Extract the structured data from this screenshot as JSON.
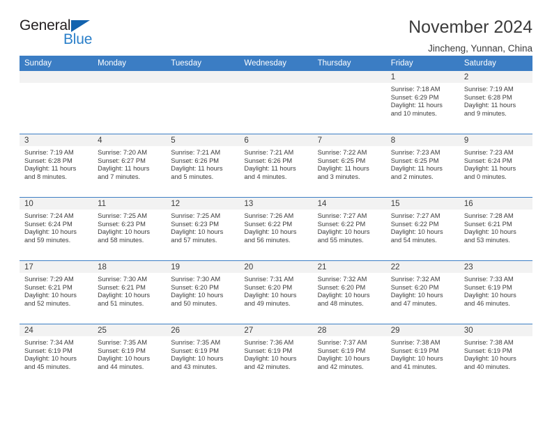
{
  "logo": {
    "word_top": "General",
    "word_bottom": "Blue",
    "triangle_color": "#1363ae",
    "blue_text_color": "#2a7fc9",
    "dark_text_color": "#231f20"
  },
  "header": {
    "title": "November 2024",
    "subtitle": "Jincheng, Yunnan, China"
  },
  "theme": {
    "header_blue": "#3b7dc4",
    "daynum_bg": "#f2f2f2",
    "text": "#3b3b3b"
  },
  "calendar": {
    "weekday_headers": [
      "Sunday",
      "Monday",
      "Tuesday",
      "Wednesday",
      "Thursday",
      "Friday",
      "Saturday"
    ],
    "weeks": [
      [
        {
          "day": "",
          "sunrise": "",
          "sunset": "",
          "daylight_line1": "",
          "daylight_line2": ""
        },
        {
          "day": "",
          "sunrise": "",
          "sunset": "",
          "daylight_line1": "",
          "daylight_line2": ""
        },
        {
          "day": "",
          "sunrise": "",
          "sunset": "",
          "daylight_line1": "",
          "daylight_line2": ""
        },
        {
          "day": "",
          "sunrise": "",
          "sunset": "",
          "daylight_line1": "",
          "daylight_line2": ""
        },
        {
          "day": "",
          "sunrise": "",
          "sunset": "",
          "daylight_line1": "",
          "daylight_line2": ""
        },
        {
          "day": "1",
          "sunrise": "Sunrise: 7:18 AM",
          "sunset": "Sunset: 6:29 PM",
          "daylight_line1": "Daylight: 11 hours",
          "daylight_line2": "and 10 minutes."
        },
        {
          "day": "2",
          "sunrise": "Sunrise: 7:19 AM",
          "sunset": "Sunset: 6:28 PM",
          "daylight_line1": "Daylight: 11 hours",
          "daylight_line2": "and 9 minutes."
        }
      ],
      [
        {
          "day": "3",
          "sunrise": "Sunrise: 7:19 AM",
          "sunset": "Sunset: 6:28 PM",
          "daylight_line1": "Daylight: 11 hours",
          "daylight_line2": "and 8 minutes."
        },
        {
          "day": "4",
          "sunrise": "Sunrise: 7:20 AM",
          "sunset": "Sunset: 6:27 PM",
          "daylight_line1": "Daylight: 11 hours",
          "daylight_line2": "and 7 minutes."
        },
        {
          "day": "5",
          "sunrise": "Sunrise: 7:21 AM",
          "sunset": "Sunset: 6:26 PM",
          "daylight_line1": "Daylight: 11 hours",
          "daylight_line2": "and 5 minutes."
        },
        {
          "day": "6",
          "sunrise": "Sunrise: 7:21 AM",
          "sunset": "Sunset: 6:26 PM",
          "daylight_line1": "Daylight: 11 hours",
          "daylight_line2": "and 4 minutes."
        },
        {
          "day": "7",
          "sunrise": "Sunrise: 7:22 AM",
          "sunset": "Sunset: 6:25 PM",
          "daylight_line1": "Daylight: 11 hours",
          "daylight_line2": "and 3 minutes."
        },
        {
          "day": "8",
          "sunrise": "Sunrise: 7:23 AM",
          "sunset": "Sunset: 6:25 PM",
          "daylight_line1": "Daylight: 11 hours",
          "daylight_line2": "and 2 minutes."
        },
        {
          "day": "9",
          "sunrise": "Sunrise: 7:23 AM",
          "sunset": "Sunset: 6:24 PM",
          "daylight_line1": "Daylight: 11 hours",
          "daylight_line2": "and 0 minutes."
        }
      ],
      [
        {
          "day": "10",
          "sunrise": "Sunrise: 7:24 AM",
          "sunset": "Sunset: 6:24 PM",
          "daylight_line1": "Daylight: 10 hours",
          "daylight_line2": "and 59 minutes."
        },
        {
          "day": "11",
          "sunrise": "Sunrise: 7:25 AM",
          "sunset": "Sunset: 6:23 PM",
          "daylight_line1": "Daylight: 10 hours",
          "daylight_line2": "and 58 minutes."
        },
        {
          "day": "12",
          "sunrise": "Sunrise: 7:25 AM",
          "sunset": "Sunset: 6:23 PM",
          "daylight_line1": "Daylight: 10 hours",
          "daylight_line2": "and 57 minutes."
        },
        {
          "day": "13",
          "sunrise": "Sunrise: 7:26 AM",
          "sunset": "Sunset: 6:22 PM",
          "daylight_line1": "Daylight: 10 hours",
          "daylight_line2": "and 56 minutes."
        },
        {
          "day": "14",
          "sunrise": "Sunrise: 7:27 AM",
          "sunset": "Sunset: 6:22 PM",
          "daylight_line1": "Daylight: 10 hours",
          "daylight_line2": "and 55 minutes."
        },
        {
          "day": "15",
          "sunrise": "Sunrise: 7:27 AM",
          "sunset": "Sunset: 6:22 PM",
          "daylight_line1": "Daylight: 10 hours",
          "daylight_line2": "and 54 minutes."
        },
        {
          "day": "16",
          "sunrise": "Sunrise: 7:28 AM",
          "sunset": "Sunset: 6:21 PM",
          "daylight_line1": "Daylight: 10 hours",
          "daylight_line2": "and 53 minutes."
        }
      ],
      [
        {
          "day": "17",
          "sunrise": "Sunrise: 7:29 AM",
          "sunset": "Sunset: 6:21 PM",
          "daylight_line1": "Daylight: 10 hours",
          "daylight_line2": "and 52 minutes."
        },
        {
          "day": "18",
          "sunrise": "Sunrise: 7:30 AM",
          "sunset": "Sunset: 6:21 PM",
          "daylight_line1": "Daylight: 10 hours",
          "daylight_line2": "and 51 minutes."
        },
        {
          "day": "19",
          "sunrise": "Sunrise: 7:30 AM",
          "sunset": "Sunset: 6:20 PM",
          "daylight_line1": "Daylight: 10 hours",
          "daylight_line2": "and 50 minutes."
        },
        {
          "day": "20",
          "sunrise": "Sunrise: 7:31 AM",
          "sunset": "Sunset: 6:20 PM",
          "daylight_line1": "Daylight: 10 hours",
          "daylight_line2": "and 49 minutes."
        },
        {
          "day": "21",
          "sunrise": "Sunrise: 7:32 AM",
          "sunset": "Sunset: 6:20 PM",
          "daylight_line1": "Daylight: 10 hours",
          "daylight_line2": "and 48 minutes."
        },
        {
          "day": "22",
          "sunrise": "Sunrise: 7:32 AM",
          "sunset": "Sunset: 6:20 PM",
          "daylight_line1": "Daylight: 10 hours",
          "daylight_line2": "and 47 minutes."
        },
        {
          "day": "23",
          "sunrise": "Sunrise: 7:33 AM",
          "sunset": "Sunset: 6:19 PM",
          "daylight_line1": "Daylight: 10 hours",
          "daylight_line2": "and 46 minutes."
        }
      ],
      [
        {
          "day": "24",
          "sunrise": "Sunrise: 7:34 AM",
          "sunset": "Sunset: 6:19 PM",
          "daylight_line1": "Daylight: 10 hours",
          "daylight_line2": "and 45 minutes."
        },
        {
          "day": "25",
          "sunrise": "Sunrise: 7:35 AM",
          "sunset": "Sunset: 6:19 PM",
          "daylight_line1": "Daylight: 10 hours",
          "daylight_line2": "and 44 minutes."
        },
        {
          "day": "26",
          "sunrise": "Sunrise: 7:35 AM",
          "sunset": "Sunset: 6:19 PM",
          "daylight_line1": "Daylight: 10 hours",
          "daylight_line2": "and 43 minutes."
        },
        {
          "day": "27",
          "sunrise": "Sunrise: 7:36 AM",
          "sunset": "Sunset: 6:19 PM",
          "daylight_line1": "Daylight: 10 hours",
          "daylight_line2": "and 42 minutes."
        },
        {
          "day": "28",
          "sunrise": "Sunrise: 7:37 AM",
          "sunset": "Sunset: 6:19 PM",
          "daylight_line1": "Daylight: 10 hours",
          "daylight_line2": "and 42 minutes."
        },
        {
          "day": "29",
          "sunrise": "Sunrise: 7:38 AM",
          "sunset": "Sunset: 6:19 PM",
          "daylight_line1": "Daylight: 10 hours",
          "daylight_line2": "and 41 minutes."
        },
        {
          "day": "30",
          "sunrise": "Sunrise: 7:38 AM",
          "sunset": "Sunset: 6:19 PM",
          "daylight_line1": "Daylight: 10 hours",
          "daylight_line2": "and 40 minutes."
        }
      ]
    ]
  }
}
